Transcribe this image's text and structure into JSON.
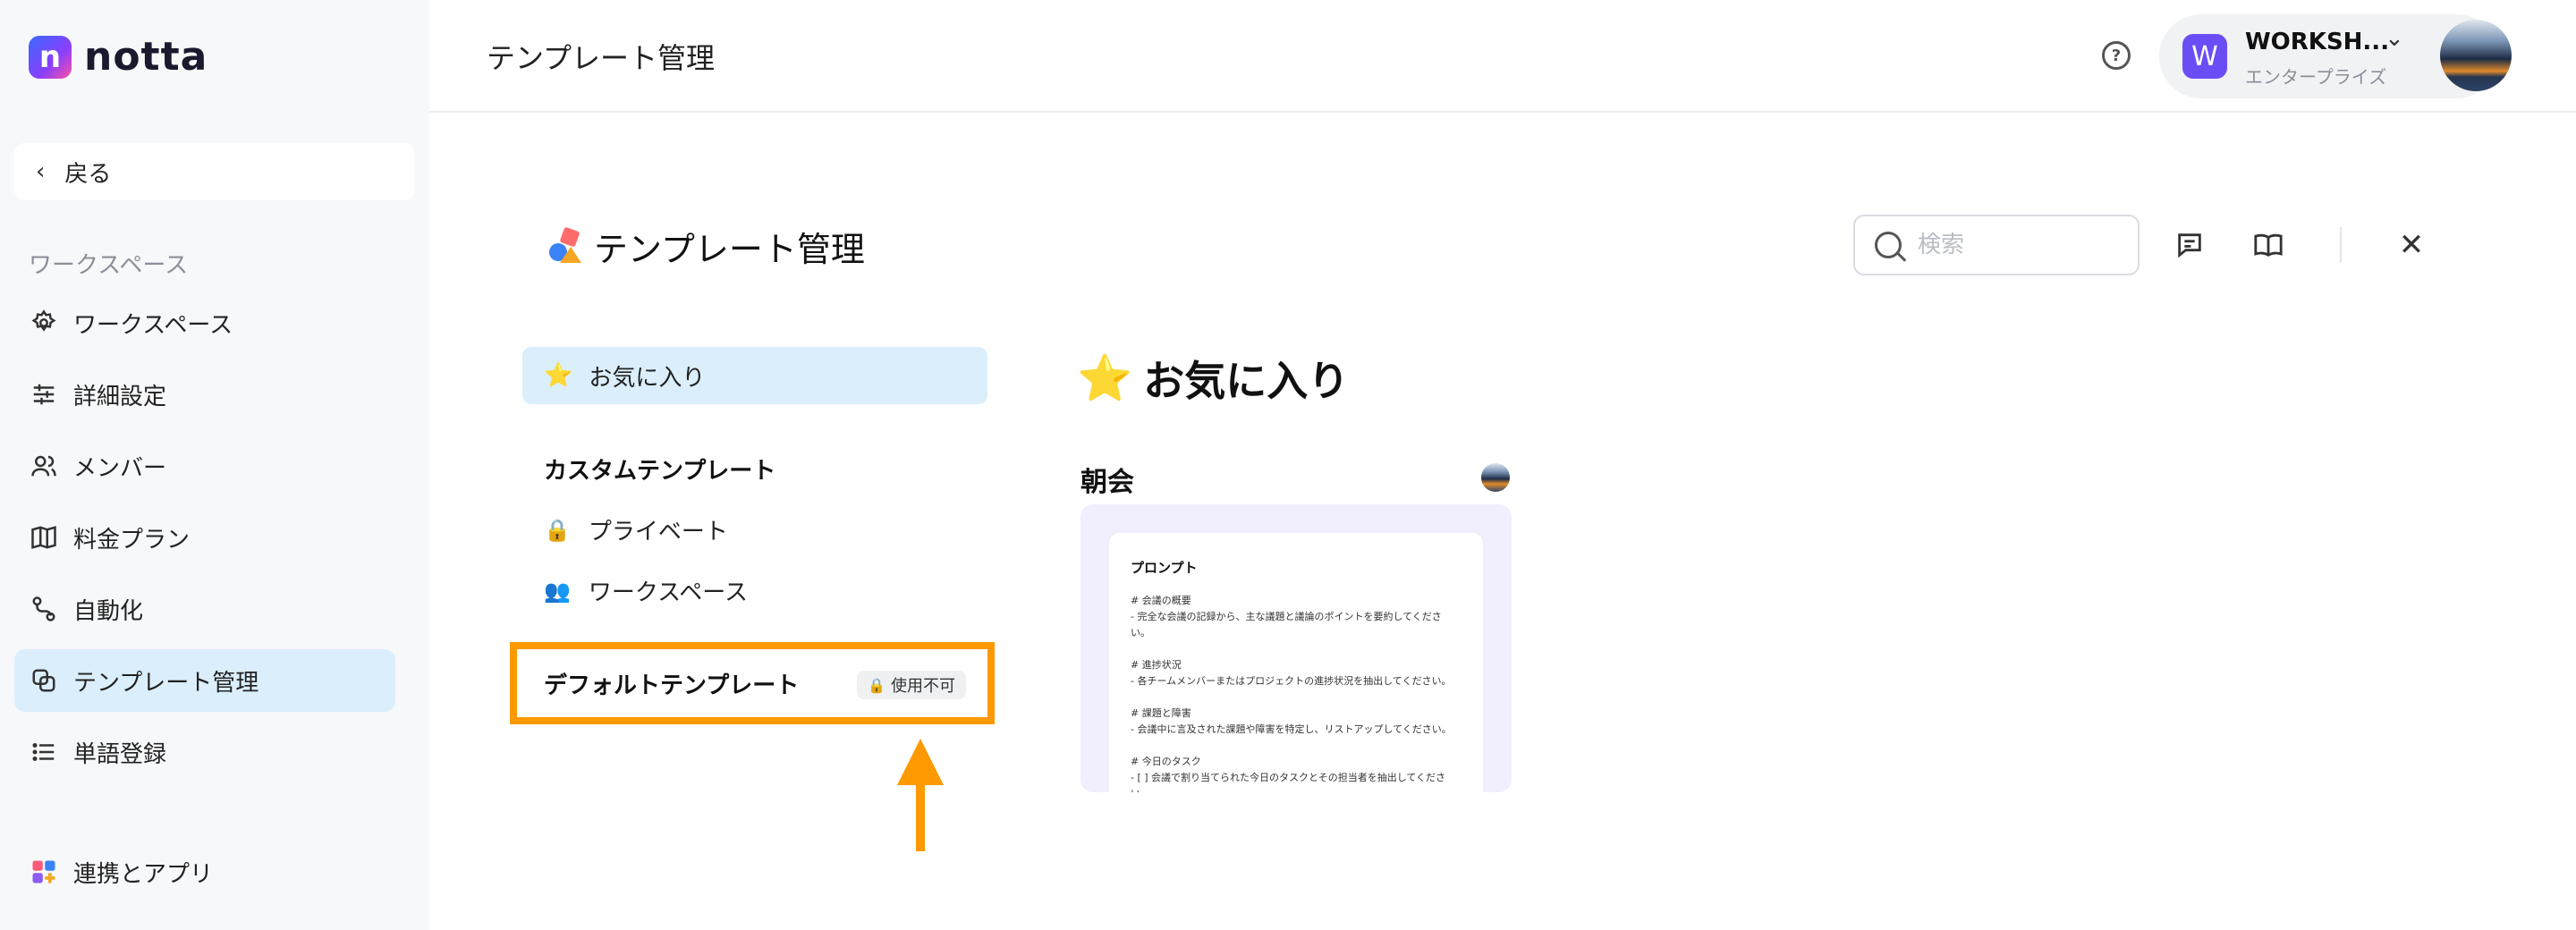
{
  "app": {
    "logo_text": "notta",
    "logo_mark": "n"
  },
  "sidebar": {
    "back_label": "戻る",
    "section_label": "ワークスペース",
    "items": [
      {
        "label": "ワークスペース",
        "icon": "gear-icon"
      },
      {
        "label": "詳細設定",
        "icon": "sliders-icon"
      },
      {
        "label": "メンバー",
        "icon": "users-icon"
      },
      {
        "label": "料金プラン",
        "icon": "map-icon"
      },
      {
        "label": "自動化",
        "icon": "automation-icon"
      },
      {
        "label": "テンプレート管理",
        "icon": "template-icon",
        "active": true
      },
      {
        "label": "単語登録",
        "icon": "list-icon"
      }
    ],
    "bottom_item": {
      "label": "連携とアプリ",
      "icon": "apps-icon"
    }
  },
  "header": {
    "title": "テンプレート管理",
    "workspace": {
      "avatar_letter": "W",
      "name": "WORKSH...",
      "plan": "エンタープライズ"
    }
  },
  "main": {
    "title": "テンプレート管理",
    "search": {
      "placeholder": "検索",
      "value": ""
    },
    "nav": {
      "favorites": "お気に入り",
      "custom_label": "カスタムテンプレート",
      "custom_items": [
        {
          "emoji": "🔒",
          "label": "プライベート"
        },
        {
          "emoji": "👥",
          "label": "ワークスペース"
        }
      ],
      "default_label": "デフォルトテンプレート",
      "default_badge": "使用不可"
    },
    "favorites_heading": "お気に入り",
    "card": {
      "title": "朝会",
      "prompt_title": "プロンプト",
      "lines": [
        "# 会議の概要",
        "- 完全な会議の記録から、主な議題と議論のポイントを要約してくださ",
        "い。",
        "",
        "# 進捗状況",
        "- 各チームメンバーまたはプロジェクトの進捗状況を抽出してください。",
        "",
        "# 課題と障害",
        "- 会議中に言及された課題や障害を特定し、リストアップしてください。",
        "",
        "# 今日のタスク",
        "- [ ] 会議で割り当てられた今日のタスクとその担当者を抽出してくださ",
        "い。"
      ]
    }
  },
  "colors": {
    "accent": "#ff9900",
    "active_bg": "#dbeefb",
    "workspace_avatar": "#6b4df5"
  }
}
